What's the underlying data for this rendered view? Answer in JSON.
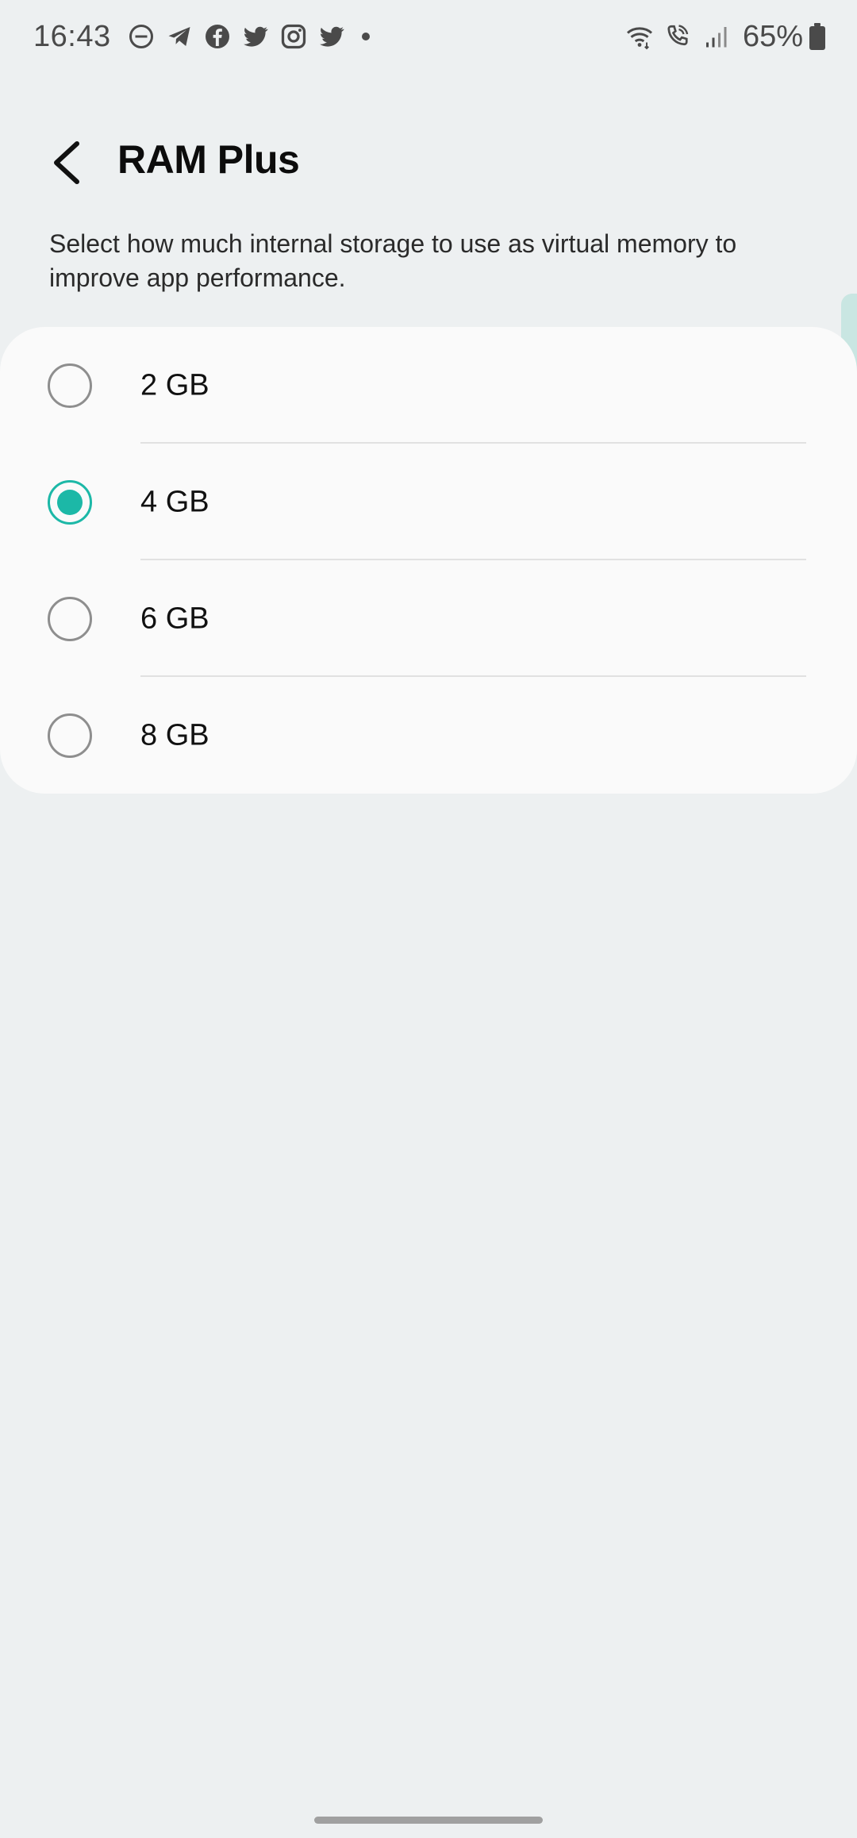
{
  "status_bar": {
    "time": "16:43",
    "battery_percent": "65%",
    "left_icons": [
      "do-not-disturb-icon",
      "telegram-icon",
      "facebook-icon",
      "twitter-icon",
      "instagram-icon",
      "twitter-icon",
      "notification-dot-icon"
    ],
    "right_icons": [
      "wifi-icon",
      "wifi-calling-icon",
      "signal-icon",
      "battery-icon"
    ]
  },
  "header": {
    "back_icon": "chevron-left-icon",
    "title": "RAM Plus"
  },
  "description": "Select how much internal storage to use as virtual memory to improve app performance.",
  "options": [
    {
      "label": "2 GB",
      "selected": false
    },
    {
      "label": "4 GB",
      "selected": true
    },
    {
      "label": "6 GB",
      "selected": false
    },
    {
      "label": "8 GB",
      "selected": false
    }
  ],
  "colors": {
    "accent": "#1cb8a7",
    "background": "#edf0f1",
    "card": "#fafafa"
  }
}
